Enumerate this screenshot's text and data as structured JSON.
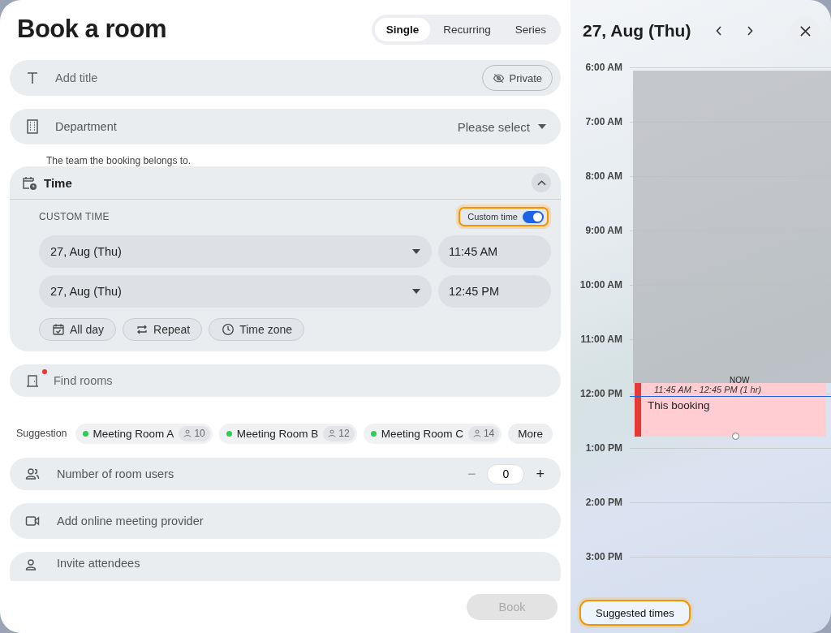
{
  "title": "Book a room",
  "mode_tabs": [
    {
      "label": "Single",
      "selected": true
    },
    {
      "label": "Recurring",
      "selected": false
    },
    {
      "label": "Series",
      "selected": false
    }
  ],
  "title_field": {
    "placeholder": "Add title",
    "private_label": "Private"
  },
  "department": {
    "label": "Department",
    "value": "Please select",
    "hint": "The team the booking belongs to."
  },
  "time_section": {
    "title": "Time",
    "expanded": true,
    "custom_label": "CUSTOM TIME",
    "toggle": {
      "label": "Custom time",
      "on": true
    },
    "rows": [
      {
        "date": "27, Aug (Thu)",
        "time": "11:45 AM"
      },
      {
        "date": "27, Aug (Thu)",
        "time": "12:45 PM"
      }
    ],
    "chips": [
      {
        "label": "All day",
        "kind": "allday"
      },
      {
        "label": "Repeat",
        "kind": "repeat"
      },
      {
        "label": "Time zone",
        "kind": "timezone"
      }
    ]
  },
  "find_rooms": {
    "placeholder": "Find rooms",
    "alert": true
  },
  "suggestions": {
    "label": "Suggestion",
    "rooms": [
      {
        "name": "Meeting Room A",
        "capacity": "10",
        "color": "#2ecc55"
      },
      {
        "name": "Meeting Room B",
        "capacity": "12",
        "color": "#2ecc55"
      },
      {
        "name": "Meeting Room C",
        "capacity": "14",
        "color": "#2ecc55"
      }
    ],
    "more": "More"
  },
  "room_users": {
    "label": "Number of room users",
    "value": "0",
    "minus": "−",
    "plus": "+"
  },
  "online_meeting": {
    "placeholder": "Add online meeting provider"
  },
  "invite": {
    "placeholder": "Invite attendees"
  },
  "book_button": {
    "label": "Book",
    "disabled": true
  },
  "calendar": {
    "date": "27, Aug (Thu)",
    "hours": [
      "6:00 AM",
      "7:00 AM",
      "8:00 AM",
      "9:00 AM",
      "10:00 AM",
      "11:00 AM",
      "12:00 PM",
      "1:00 PM",
      "2:00 PM",
      "3:00 PM"
    ],
    "now_label": "NOW",
    "booking": {
      "time": "11:45 AM - 12:45 PM (1 hr)",
      "title": "This booking"
    },
    "suggested_times": "Suggested times"
  }
}
